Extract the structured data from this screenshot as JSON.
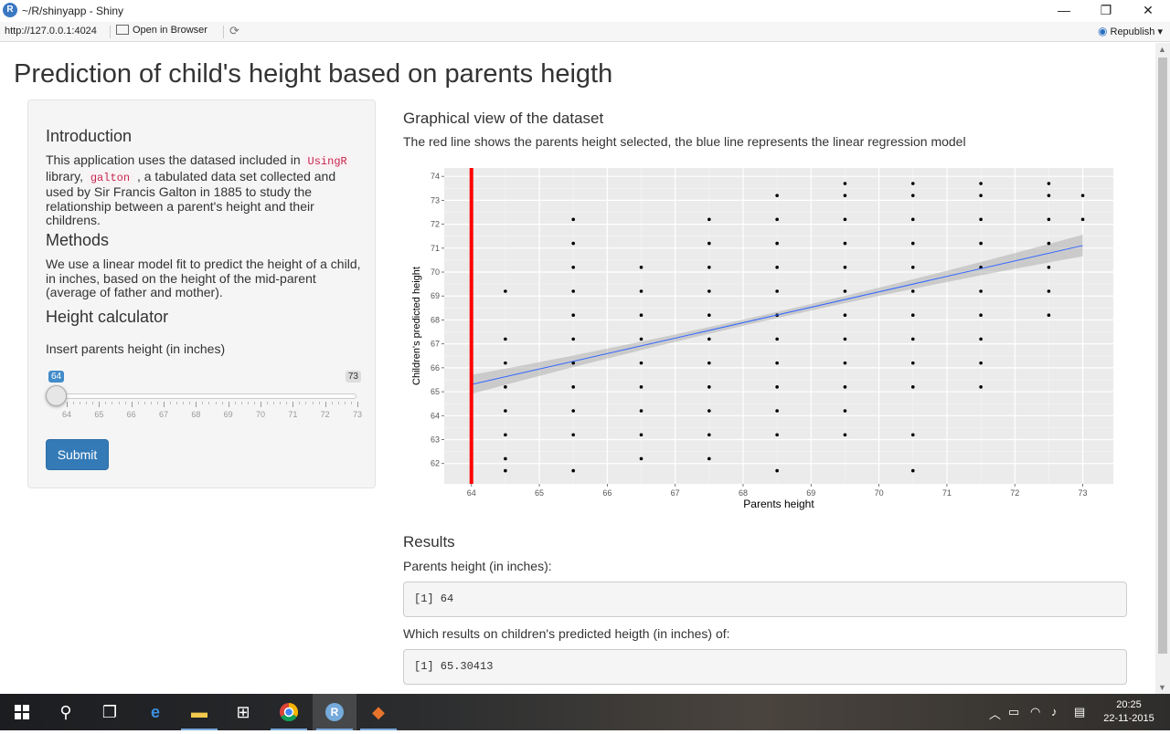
{
  "window": {
    "title": "~/R/shinyapp - Shiny",
    "r_logo": "R",
    "minimize": "—",
    "maximize": "❐",
    "close": "✕"
  },
  "toolbar": {
    "url": "http://127.0.0.1:4024",
    "open_browser": "Open in Browser",
    "republish": "Republish"
  },
  "page": {
    "title": "Prediction of child's height based on parents heigth",
    "sidebar": {
      "intro_heading": "Introduction",
      "intro_text_1": "This application uses the datased included in",
      "intro_code_1": "UsingR",
      "intro_text_2": "library,",
      "intro_code_2": "galton",
      "intro_text_3": ", a tabulated data set collected and used by Sir Francis Galton in 1885 to study the relationship between a parent's height and their childrens.",
      "methods_heading": "Methods",
      "methods_text": "We use a linear model fit to predict the height of a child, in inches, based on the height of the mid-parent (average of father and mother).",
      "calc_heading": "Height calculator",
      "slider_label": "Insert parents height (in inches)",
      "slider_min": "64",
      "slider_max": "73",
      "slider_value": "64",
      "slider_ticks": [
        "64",
        "65",
        "66",
        "67",
        "68",
        "69",
        "70",
        "71",
        "72",
        "73"
      ],
      "submit_label": "Submit"
    },
    "main": {
      "graph_heading": "Graphical view of the dataset",
      "graph_desc": "The red line shows the parents height selected, the blue line represents the linear regression model",
      "results_heading": "Results",
      "parents_label": "Parents height (in inches):",
      "parents_output": "[1] 64",
      "children_label": "Which results on children's predicted heigth (in inches) of:",
      "children_output": "[1] 65.30413"
    }
  },
  "chart_data": {
    "type": "scatter",
    "xlabel": "Parents height",
    "ylabel": "Children's predicted height",
    "xlim": [
      63.6,
      73.45
    ],
    "ylim": [
      61.15,
      74.35
    ],
    "x_ticks": [
      64,
      65,
      66,
      67,
      68,
      69,
      70,
      71,
      72,
      73
    ],
    "y_ticks": [
      62,
      63,
      64,
      65,
      66,
      67,
      68,
      69,
      70,
      71,
      72,
      73,
      74
    ],
    "points": [
      [
        64.5,
        61.7
      ],
      [
        64.5,
        62.2
      ],
      [
        64.5,
        63.2
      ],
      [
        64.5,
        64.2
      ],
      [
        64.5,
        65.2
      ],
      [
        64.5,
        66.2
      ],
      [
        64.5,
        67.2
      ],
      [
        64.5,
        69.2
      ],
      [
        65.5,
        61.7
      ],
      [
        65.5,
        63.2
      ],
      [
        65.5,
        64.2
      ],
      [
        65.5,
        65.2
      ],
      [
        65.5,
        66.2
      ],
      [
        65.5,
        67.2
      ],
      [
        65.5,
        68.2
      ],
      [
        65.5,
        69.2
      ],
      [
        65.5,
        70.2
      ],
      [
        65.5,
        71.2
      ],
      [
        65.5,
        72.2
      ],
      [
        66.5,
        62.2
      ],
      [
        66.5,
        63.2
      ],
      [
        66.5,
        64.2
      ],
      [
        66.5,
        65.2
      ],
      [
        66.5,
        66.2
      ],
      [
        66.5,
        67.2
      ],
      [
        66.5,
        68.2
      ],
      [
        66.5,
        69.2
      ],
      [
        66.5,
        70.2
      ],
      [
        67.5,
        62.2
      ],
      [
        67.5,
        63.2
      ],
      [
        67.5,
        64.2
      ],
      [
        67.5,
        65.2
      ],
      [
        67.5,
        66.2
      ],
      [
        67.5,
        67.2
      ],
      [
        67.5,
        68.2
      ],
      [
        67.5,
        69.2
      ],
      [
        67.5,
        70.2
      ],
      [
        67.5,
        71.2
      ],
      [
        67.5,
        72.2
      ],
      [
        68.5,
        61.7
      ],
      [
        68.5,
        63.2
      ],
      [
        68.5,
        64.2
      ],
      [
        68.5,
        65.2
      ],
      [
        68.5,
        66.2
      ],
      [
        68.5,
        67.2
      ],
      [
        68.5,
        68.2
      ],
      [
        68.5,
        69.2
      ],
      [
        68.5,
        70.2
      ],
      [
        68.5,
        71.2
      ],
      [
        68.5,
        72.2
      ],
      [
        68.5,
        73.2
      ],
      [
        69.5,
        63.2
      ],
      [
        69.5,
        64.2
      ],
      [
        69.5,
        65.2
      ],
      [
        69.5,
        66.2
      ],
      [
        69.5,
        67.2
      ],
      [
        69.5,
        68.2
      ],
      [
        69.5,
        69.2
      ],
      [
        69.5,
        70.2
      ],
      [
        69.5,
        71.2
      ],
      [
        69.5,
        72.2
      ],
      [
        69.5,
        73.2
      ],
      [
        69.5,
        73.7
      ],
      [
        70.5,
        61.7
      ],
      [
        70.5,
        63.2
      ],
      [
        70.5,
        65.2
      ],
      [
        70.5,
        66.2
      ],
      [
        70.5,
        67.2
      ],
      [
        70.5,
        68.2
      ],
      [
        70.5,
        69.2
      ],
      [
        70.5,
        70.2
      ],
      [
        70.5,
        71.2
      ],
      [
        70.5,
        72.2
      ],
      [
        70.5,
        73.2
      ],
      [
        70.5,
        73.7
      ],
      [
        71.5,
        65.2
      ],
      [
        71.5,
        66.2
      ],
      [
        71.5,
        67.2
      ],
      [
        71.5,
        68.2
      ],
      [
        71.5,
        69.2
      ],
      [
        71.5,
        70.2
      ],
      [
        71.5,
        71.2
      ],
      [
        71.5,
        72.2
      ],
      [
        71.5,
        73.2
      ],
      [
        71.5,
        73.7
      ],
      [
        72.5,
        68.2
      ],
      [
        72.5,
        69.2
      ],
      [
        72.5,
        70.2
      ],
      [
        72.5,
        71.2
      ],
      [
        72.5,
        72.2
      ],
      [
        72.5,
        73.2
      ],
      [
        72.5,
        73.7
      ],
      [
        73.0,
        72.2
      ],
      [
        73.0,
        73.2
      ]
    ],
    "regression_line": {
      "x": [
        64.0,
        73.0
      ],
      "y": [
        65.30413,
        71.11
      ],
      "color": "#3366ff"
    },
    "selected_line": {
      "x": 64,
      "color": "#ff0000"
    },
    "background": "#ebebeb",
    "grid": true
  },
  "taskbar": {
    "start_icon": "windows-logo",
    "clock_time": "20:25",
    "clock_date": "22-11-2015"
  }
}
